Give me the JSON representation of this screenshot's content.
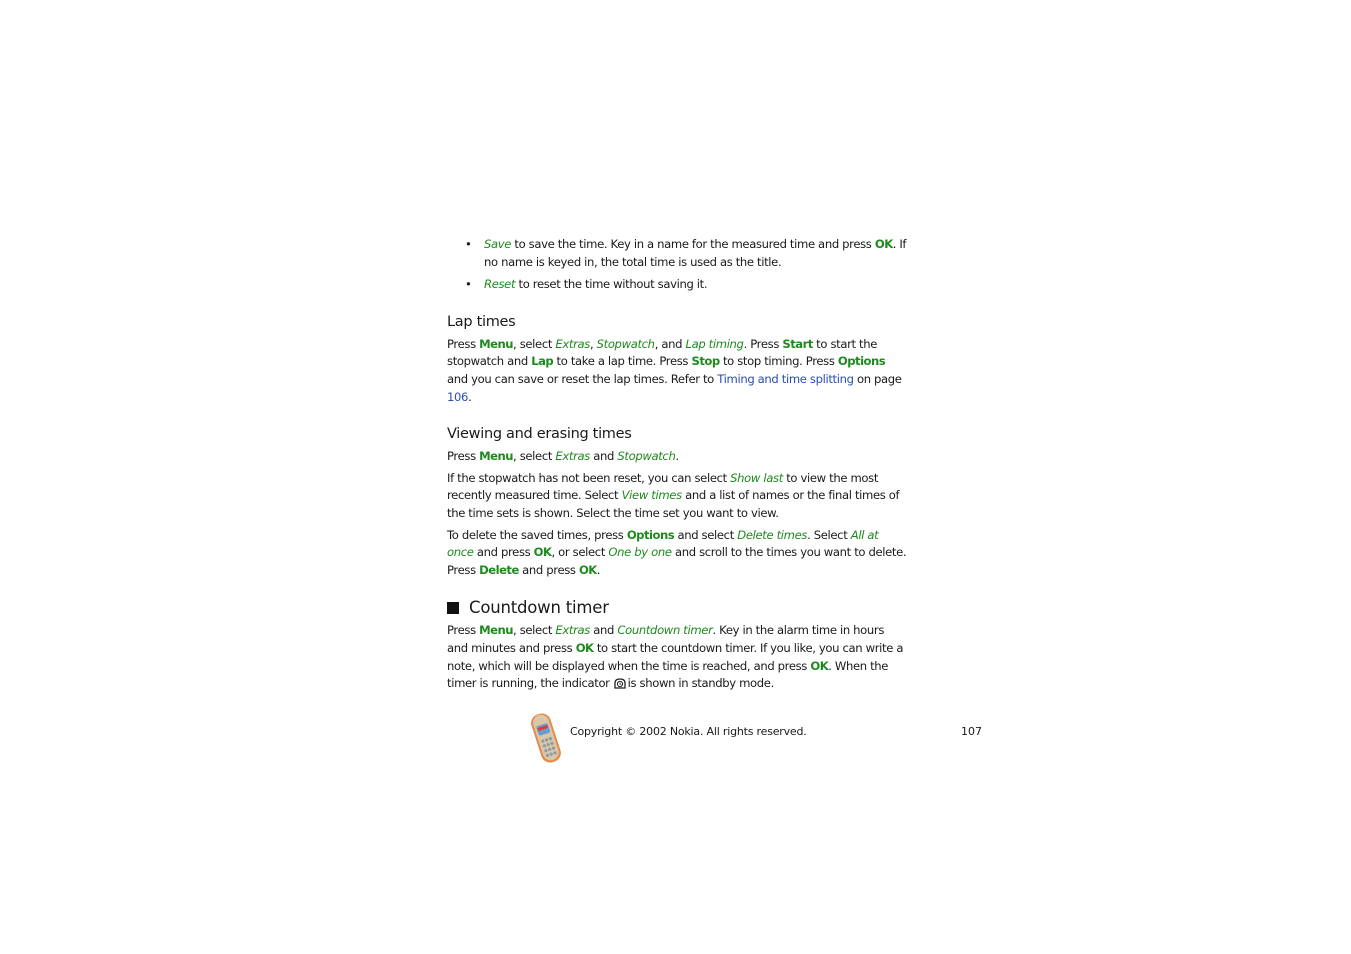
{
  "bullets": [
    {
      "term": "Save",
      "t1": " to save the time. Key in a name for the measured time and press ",
      "k1": "OK",
      "t2": ". If no name is keyed in, the total time is used as the title."
    },
    {
      "term": "Reset",
      "t1": " to reset the time without saving it."
    }
  ],
  "lap": {
    "heading": "Lap times",
    "p": [
      "Press ",
      "Menu",
      ", select ",
      "Extras",
      ", ",
      "Stopwatch",
      ", and ",
      "Lap timing",
      ". Press ",
      "Start",
      " to start the stopwatch and ",
      "Lap",
      " to take a lap time. Press ",
      "Stop",
      " to stop timing. Press ",
      "Options",
      " and you can save or reset the lap times. Refer to ",
      "Timing and time splitting",
      " on page ",
      "106",
      "."
    ]
  },
  "viewing": {
    "heading": "Viewing and erasing times",
    "p1": [
      "Press ",
      "Menu",
      ", select ",
      "Extras",
      " and ",
      "Stopwatch",
      "."
    ],
    "p2": [
      "If the stopwatch has not been reset, you can select ",
      "Show last",
      " to view the most recently measured time. Select ",
      "View times",
      " and a list of names or the final times of the time sets is shown. Select the time set you want to view."
    ],
    "p3": [
      "To delete the saved times, press ",
      "Options",
      " and select ",
      "Delete times",
      ". Select ",
      "All at once",
      " and press ",
      "OK",
      ", or select ",
      "One by one",
      " and scroll to the times you want to delete. Press ",
      "Delete",
      " and press ",
      "OK",
      "."
    ]
  },
  "countdown": {
    "heading": "Countdown timer",
    "p": [
      "Press ",
      "Menu",
      ", select ",
      "Extras",
      " and ",
      "Countdown timer",
      ". Key in the alarm time in hours and minutes and press ",
      "OK",
      " to start the countdown timer. If you like, you can write a note, which will be displayed when the time is reached, and press ",
      "OK",
      ". When the timer is running, the indicator",
      "is shown in standby mode."
    ]
  },
  "footer": {
    "copyright": "Copyright © 2002 Nokia. All rights reserved.",
    "page_number": "107",
    "icon": "nokia-phone-icon"
  }
}
